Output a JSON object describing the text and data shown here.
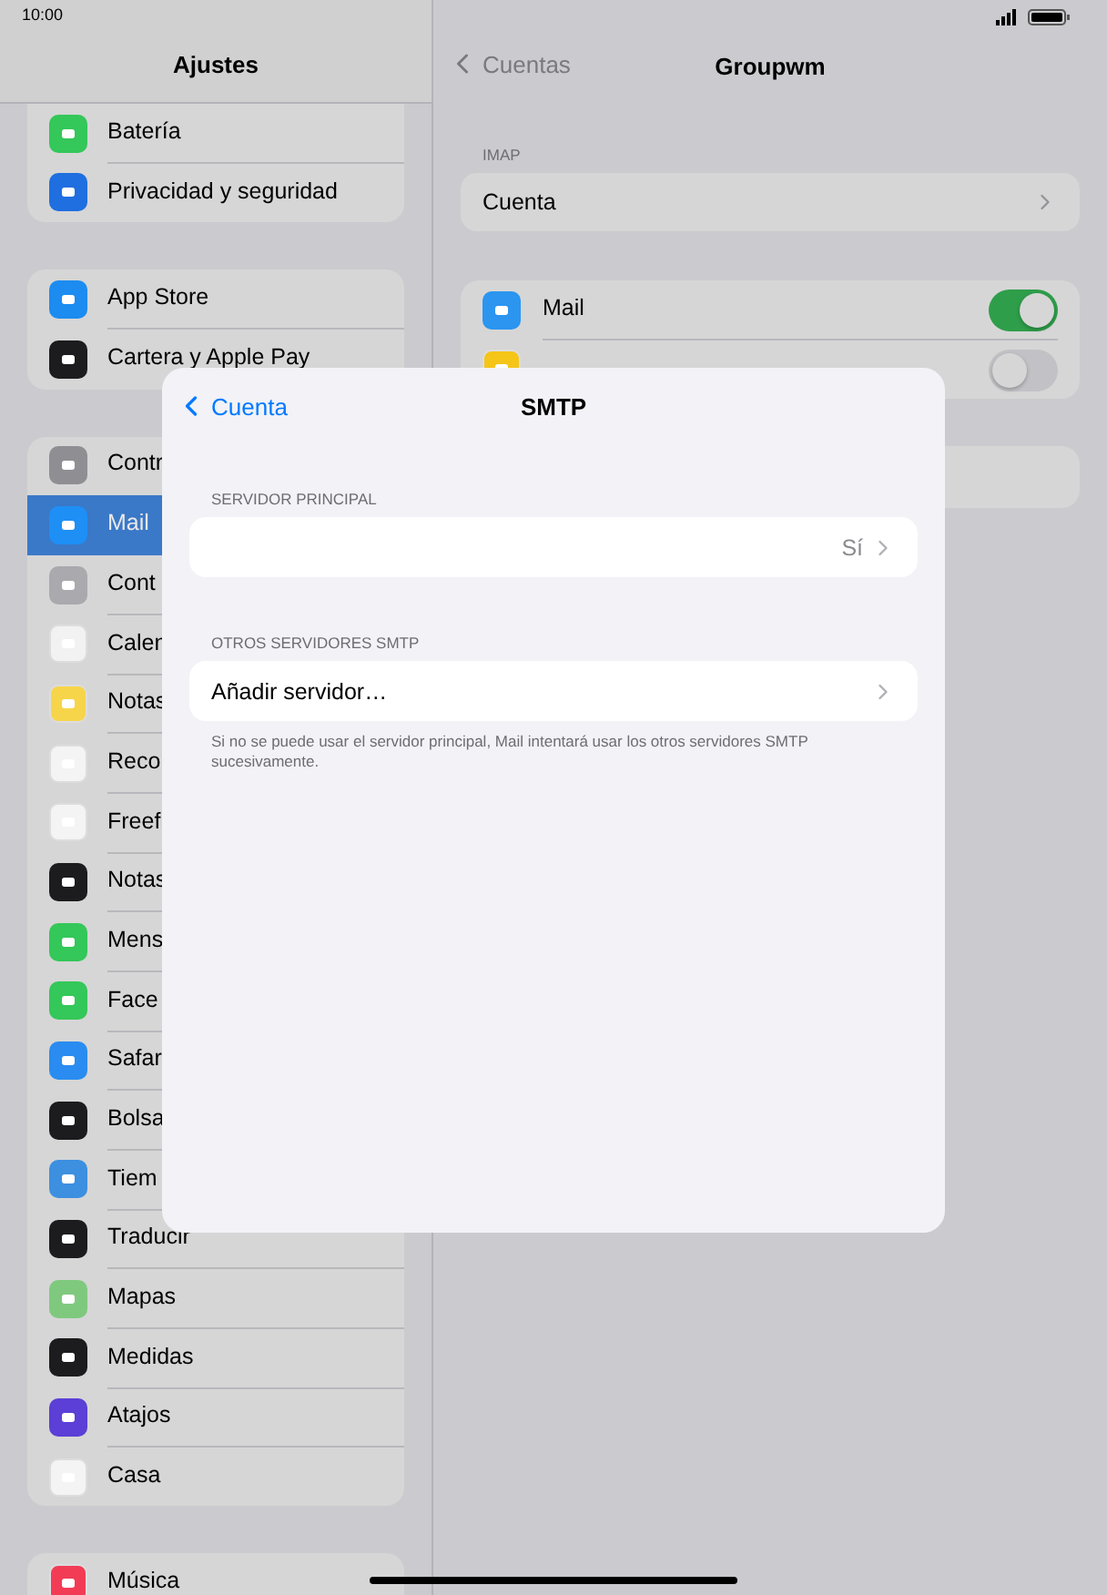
{
  "status_bar": {
    "time": "10:00"
  },
  "sidebar": {
    "title": "Ajustes",
    "groups": [
      {
        "items": [
          {
            "label": "Batería",
            "color": "#34c759",
            "selected": false
          },
          {
            "label": "Privacidad y seguridad",
            "color": "#1f6fe0",
            "selected": false
          }
        ]
      },
      {
        "items": [
          {
            "label": "App Store",
            "color": "#1c8cf0",
            "selected": false
          },
          {
            "label": "Cartera y Apple Pay",
            "color": "#1c1c1e",
            "selected": false
          }
        ]
      },
      {
        "items": [
          {
            "label": "Contr",
            "color": "#8e8e93",
            "selected": false
          },
          {
            "label": "Mail",
            "color": "#1e8ff5",
            "selected": true
          },
          {
            "label": "Cont",
            "color": "#a9a9ae",
            "selected": false
          },
          {
            "label": "Calen",
            "color": "#f2f2f2",
            "selected": false
          },
          {
            "label": "Notas",
            "color": "#f7d54a",
            "selected": false
          },
          {
            "label": "Reco",
            "color": "#f4f4f4",
            "selected": false
          },
          {
            "label": "Freef",
            "color": "#f4f4f4",
            "selected": false
          },
          {
            "label": "Notas",
            "color": "#1c1c1e",
            "selected": false
          },
          {
            "label": "Mens",
            "color": "#34c759",
            "selected": false
          },
          {
            "label": "Face",
            "color": "#34c759",
            "selected": false
          },
          {
            "label": "Safar",
            "color": "#2a8cf0",
            "selected": false
          },
          {
            "label": "Bolsa",
            "color": "#1c1c1e",
            "selected": false
          },
          {
            "label": "Tiem",
            "color": "#3d8fe0",
            "selected": false
          },
          {
            "label": "Traducir",
            "color": "#1c1c1e",
            "selected": false
          },
          {
            "label": "Mapas",
            "color": "#7fc97f",
            "selected": false
          },
          {
            "label": "Medidas",
            "color": "#1c1c1e",
            "selected": false
          },
          {
            "label": "Atajos",
            "color": "#5b3fd6",
            "selected": false
          },
          {
            "label": "Casa",
            "color": "#f4f4f4",
            "selected": false
          }
        ]
      },
      {
        "items": [
          {
            "label": "Música",
            "color": "#f23c56",
            "selected": false
          }
        ]
      }
    ]
  },
  "detail": {
    "back": "Cuentas",
    "title": "Groupwm",
    "imap_label": "IMAP",
    "account_row": "Cuenta",
    "toggles": [
      {
        "label": "Mail",
        "on": true,
        "color": "#2b95f0"
      },
      {
        "on": false,
        "color": "#f5c518"
      }
    ]
  },
  "sheet": {
    "back": "Cuenta",
    "title": "SMTP",
    "sections": [
      {
        "header": "SERVIDOR PRINCIPAL",
        "rows": [
          {
            "value": "Sí"
          }
        ]
      },
      {
        "header": "OTROS SERVIDORES SMTP",
        "rows": [
          {
            "label": "Añadir servidor…"
          }
        ],
        "footer": "Si no se puede usar el servidor principal, Mail intentará usar los otros servidores SMTP sucesivamente."
      }
    ]
  }
}
